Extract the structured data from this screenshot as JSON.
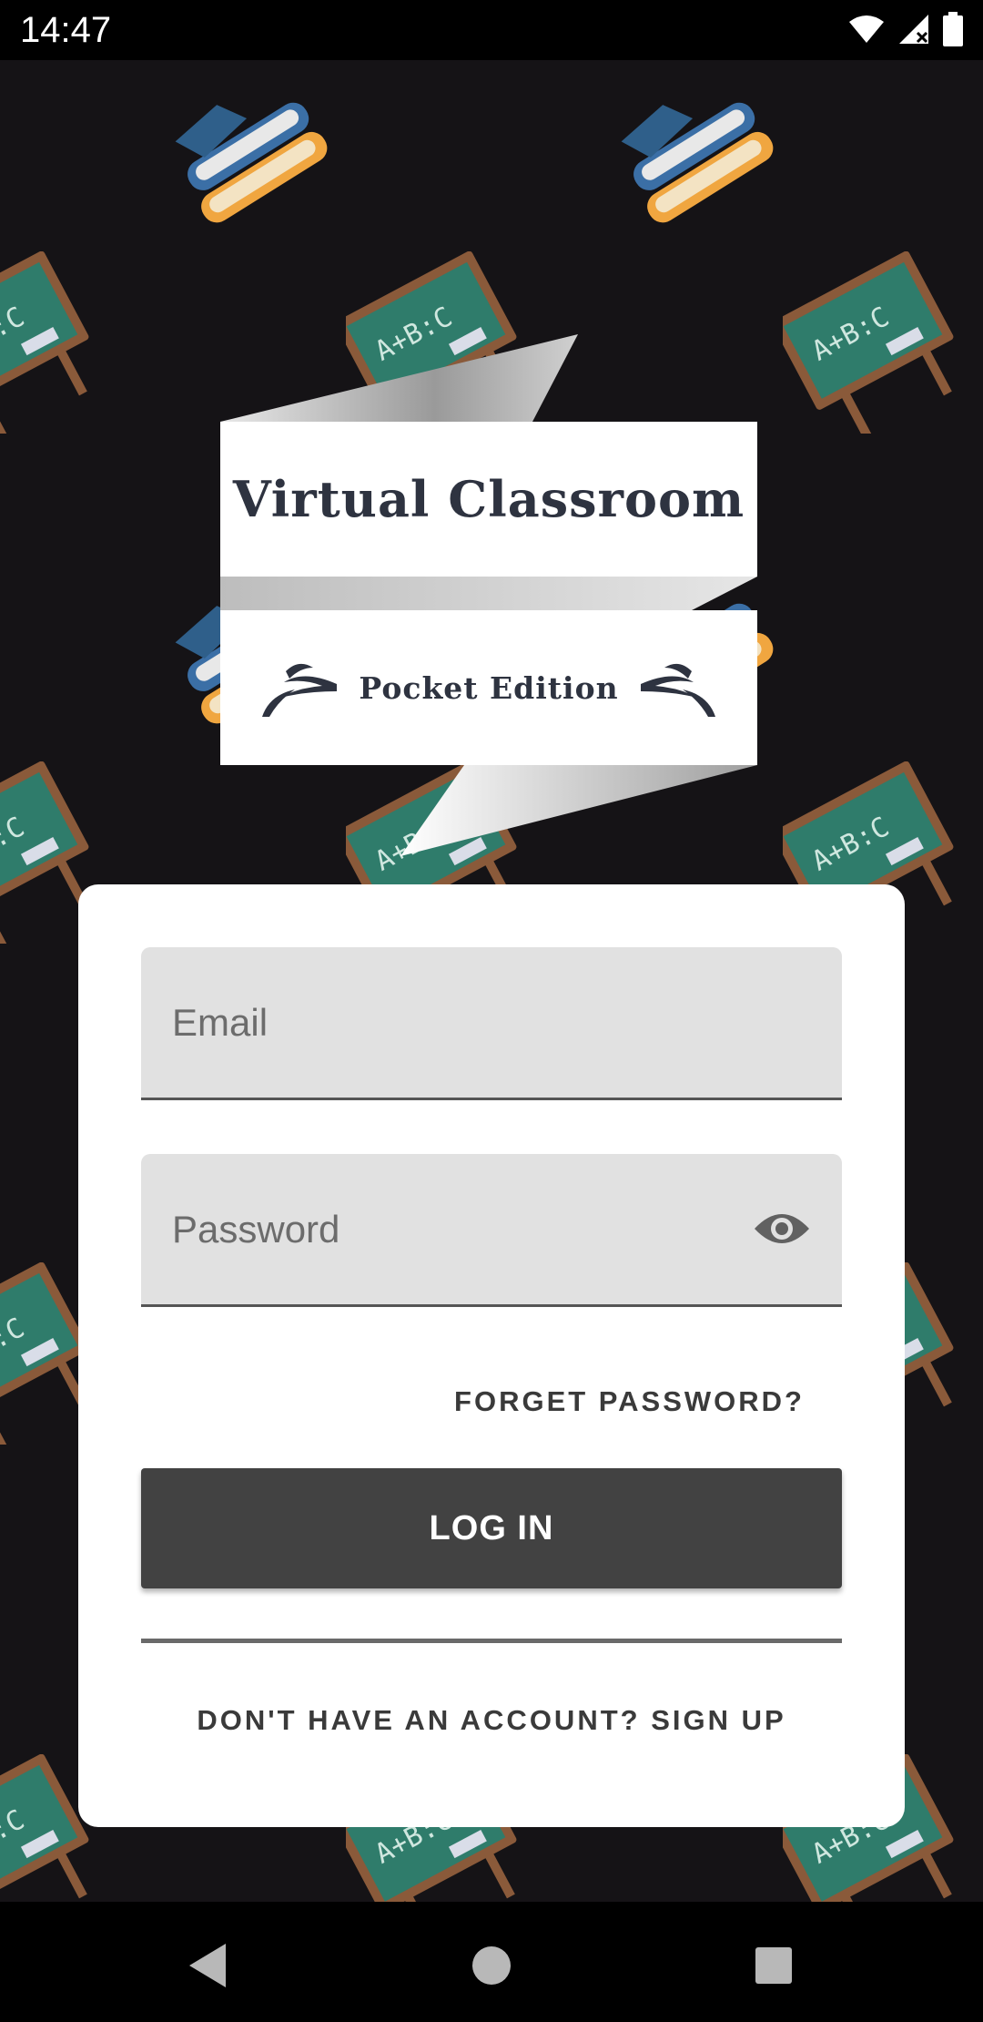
{
  "status_bar": {
    "time": "14:47"
  },
  "logo": {
    "title": "Virtual Classroom",
    "subtitle": "Pocket Edition"
  },
  "login_form": {
    "email_placeholder": "Email",
    "password_placeholder": "Password",
    "forget_password_label": "FORGET PASSWORD?",
    "login_label": "LOG IN",
    "signup_label": "DON'T HAVE AN ACCOUNT? SIGN UP"
  },
  "background": {
    "chalkboard_text": "A+B:C"
  },
  "colors": {
    "background": "#151316",
    "card": "#ffffff",
    "field": "#e1e1e1",
    "button": "#424242",
    "chalkboard": "#2f7c6b",
    "book_blue": "#3b6fa6",
    "book_orange": "#f0a640"
  },
  "icons": {
    "status": [
      "wifi-icon",
      "cell-signal-icon",
      "battery-icon"
    ],
    "password_toggle": "eye-icon",
    "nav": [
      "back-icon",
      "home-icon",
      "recents-icon"
    ]
  }
}
